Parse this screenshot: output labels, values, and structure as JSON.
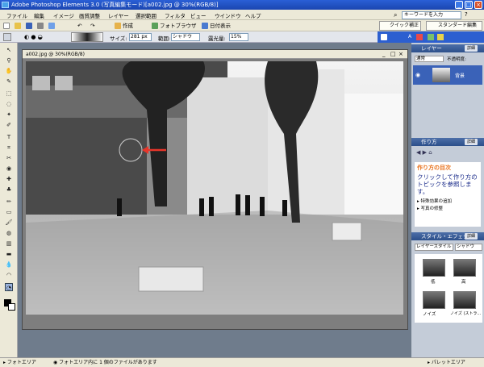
{
  "window": {
    "title": "Adobe Photoshop Elements 3.0 (写真編集モード)[a002.jpg @ 30%(RGB/8)]",
    "min": "_",
    "max": "□",
    "close": "×"
  },
  "menu": [
    "ファイル",
    "編集",
    "イメージ",
    "画質調整",
    "レイヤー",
    "選択範囲",
    "フィルタ",
    "ビュー",
    "ウインドウ",
    "ヘルプ"
  ],
  "keyword_placeholder": "キーワードを入力",
  "toolbar": {
    "create": "作成",
    "browser": "フォトブラウザ",
    "date_view": "日付表示",
    "quick_fix": "クイック補正",
    "standard_edit": "スタンダード編集"
  },
  "options": {
    "size_label": "サイズ:",
    "size_value": "281 px",
    "range_label": "範囲:",
    "range_value": "シャドウ",
    "exposure_label": "露光量:",
    "exposure_value": "15%"
  },
  "doc": {
    "title": "a002.jpg @ 30%(RGB/8)"
  },
  "panels": {
    "layers": {
      "title": "レイヤー",
      "detail": "詳細",
      "mode": "通常",
      "opacity": "不透明度:",
      "layer_name": "背景"
    },
    "howto": {
      "title": "作り方",
      "detail": "詳細",
      "heading": "作り方の目次",
      "body": "クリックして作り方のトピックを参照します。",
      "items": [
        "特殊効果の追加",
        "写真の修整"
      ]
    },
    "styles": {
      "title": "スタイル・エフェクト",
      "detail": "詳細",
      "select1": "レイヤースタイル",
      "select2": "シャドウ",
      "names": [
        "低",
        "高",
        "ノイズ",
        "ノイズ (ストラ..."
      ]
    }
  },
  "status": {
    "photo_area": "フォトエリア",
    "message": "フォトエリア内に 1 個のファイルがあります",
    "palette_area": "パレットエリア"
  },
  "colors": {
    "accent": "#2c5fd0",
    "arrow": "#e8352a"
  }
}
